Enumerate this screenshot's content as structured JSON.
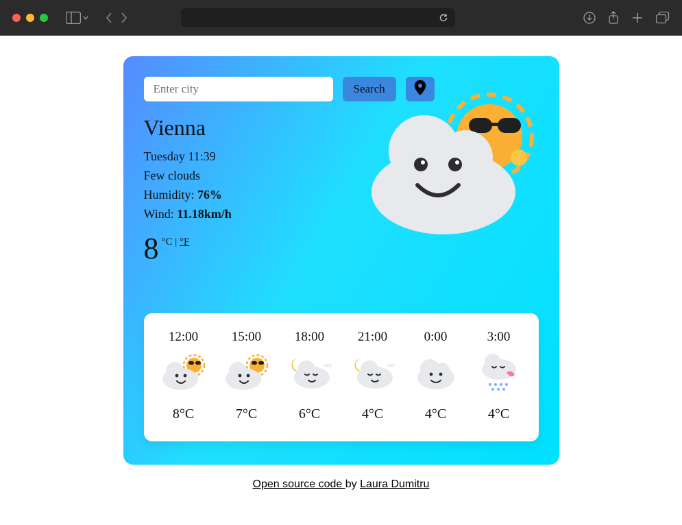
{
  "search": {
    "placeholder": "Enter city",
    "button_label": "Search"
  },
  "current": {
    "city": "Vienna",
    "datetime": "Tuesday 11:39",
    "description": "Few clouds",
    "humidity_label": "Humidity: ",
    "humidity_value": "76%",
    "wind_label": "Wind: ",
    "wind_value": "11.18km/h",
    "temperature": "8",
    "units_c": "°C",
    "units_sep": " | ",
    "units_f": "°F",
    "icon": "few-clouds-day"
  },
  "forecast": [
    {
      "time": "12:00",
      "icon": "few-clouds-day",
      "temp": "8°C"
    },
    {
      "time": "15:00",
      "icon": "few-clouds-day",
      "temp": "7°C"
    },
    {
      "time": "18:00",
      "icon": "cloud-sleeping-moon",
      "temp": "6°C"
    },
    {
      "time": "21:00",
      "icon": "cloud-sleeping-moon",
      "temp": "4°C"
    },
    {
      "time": "0:00",
      "icon": "cloudy",
      "temp": "4°C"
    },
    {
      "time": "3:00",
      "icon": "rain",
      "temp": "4°C"
    }
  ],
  "footer": {
    "code_link": "Open source code ",
    "by": "by ",
    "author": "Laura Dumitru"
  }
}
